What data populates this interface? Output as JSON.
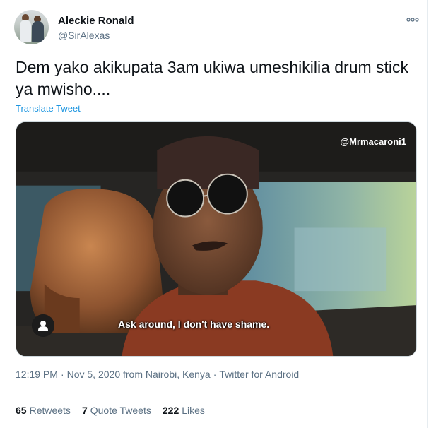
{
  "author": {
    "name": "Aleckie Ronald",
    "handle": "@SirAlexas"
  },
  "tweet": {
    "text": "Dem yako akikupata 3am ukiwa umeshikilia drum stick ya mwisho....",
    "translate_label": "Translate Tweet"
  },
  "media": {
    "watermark": "@Mrmacaroni1",
    "caption": "Ask around, I don't have shame."
  },
  "meta": {
    "time": "12:19 PM",
    "date": "Nov 5, 2020",
    "location": "from Nairobi, Kenya",
    "source": "Twitter for Android"
  },
  "stats": [
    {
      "count": "65",
      "label": "Retweets"
    },
    {
      "count": "7",
      "label": "Quote Tweets"
    },
    {
      "count": "222",
      "label": "Likes"
    }
  ],
  "icons": {
    "more": "more-options-icon",
    "user": "user-tag-icon"
  },
  "colors": {
    "link": "#1b95e0",
    "secondary_text": "#5b7083",
    "primary_text": "#0f1419"
  }
}
